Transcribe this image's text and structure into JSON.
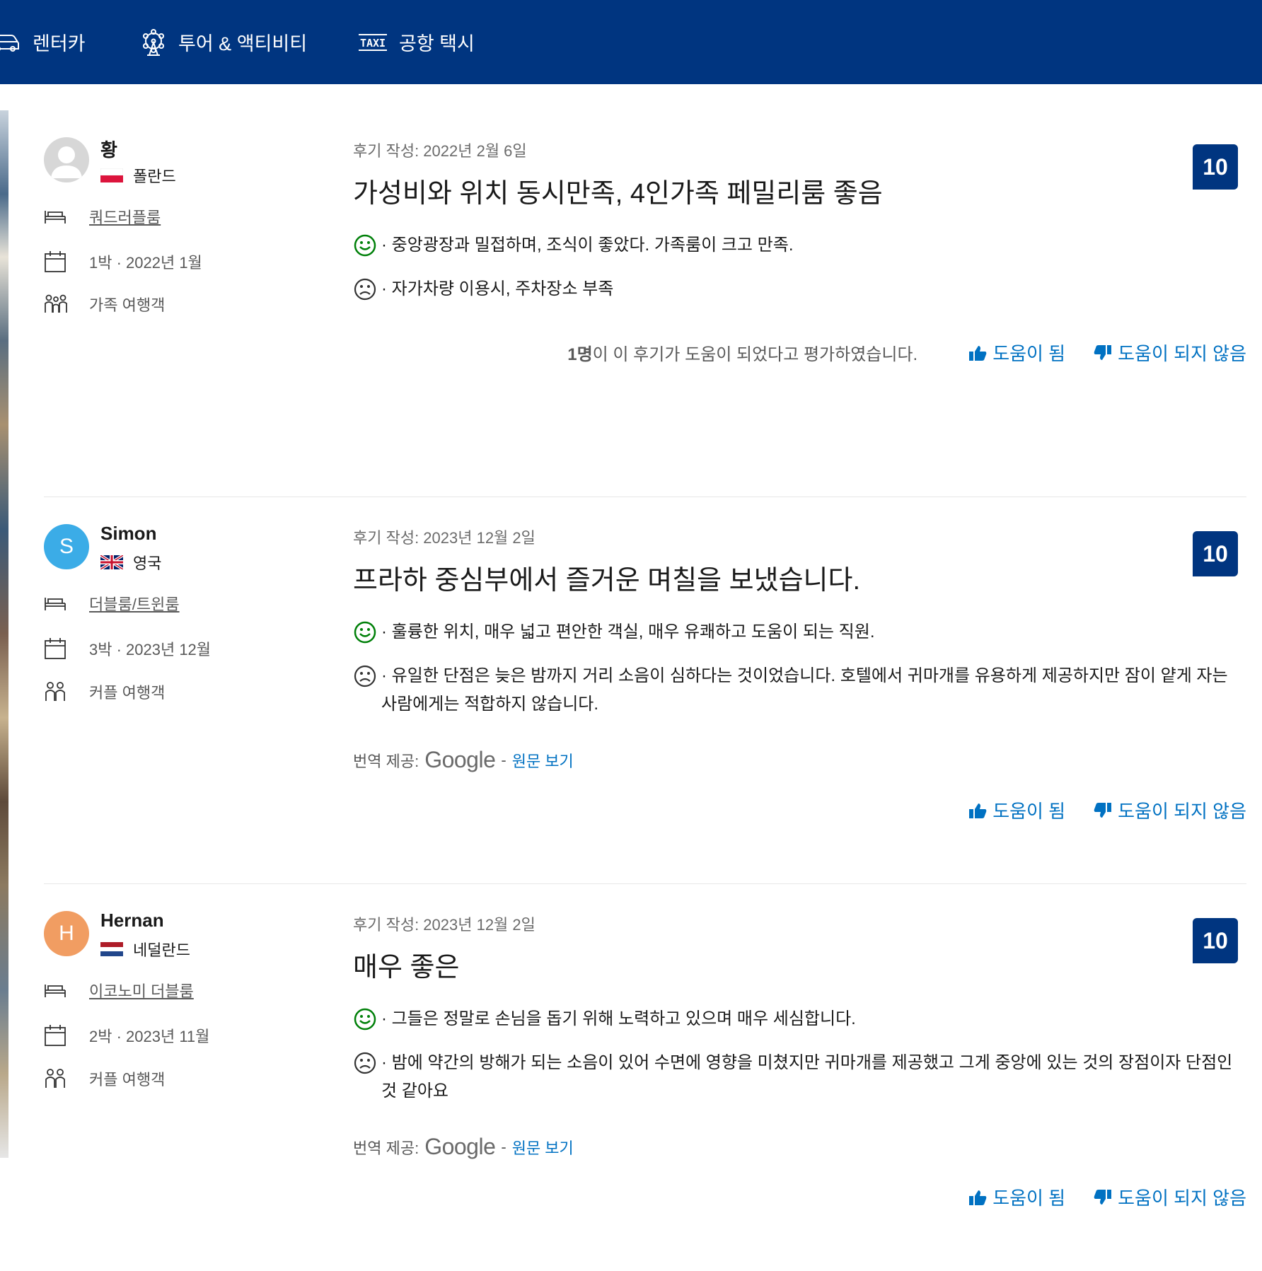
{
  "nav": {
    "items": [
      {
        "label": "렌터카",
        "icon": "car-icon"
      },
      {
        "label": "투어 & 액티비티",
        "icon": "ferris-wheel-icon"
      },
      {
        "label": "공항 택시",
        "icon": "taxi-icon"
      }
    ],
    "taxi_icon_text": "TAXI"
  },
  "colors": {
    "brand": "#003580",
    "link": "#0071c2",
    "positive": "#008009"
  },
  "reviews": [
    {
      "name": "황",
      "avatar_letter": "",
      "avatar_color": "#d7d7d7",
      "country": "폴란드",
      "room": "쿼드러플룸",
      "stay": "1박 ·  2022년 1월",
      "traveler": "가족 여행객",
      "date": "후기 작성: 2022년 2월 6일",
      "title": "가성비와 위치 동시만족, 4인가족 페밀리룸 좋음",
      "score": "10",
      "positive": "· 중앙광장과 밀접하며, 조식이 좋았다. 가족룸이 크고 만족.",
      "negative": "· 자가차량 이용시, 주차장소 부족",
      "helpful_count": "1명",
      "helpful_text": "이 이 후기가 도움이 되었다고 평가하였습니다.",
      "helpful": "도움이 됨",
      "not_helpful": "도움이 되지 않음"
    },
    {
      "name": "Simon",
      "avatar_letter": "S",
      "avatar_color": "#3bace7",
      "country": "영국",
      "room": "더블룸/트윈룸",
      "stay": "3박 ·  2023년 12월",
      "traveler": "커플 여행객",
      "date": "후기 작성: 2023년 12월 2일",
      "title": "프라하 중심부에서 즐거운 며칠을 보냈습니다.",
      "score": "10",
      "positive": "· 훌륭한 위치, 매우 넓고 편안한 객실, 매우 유쾌하고 도움이 되는 직원.",
      "negative": "· 유일한 단점은 늦은 밤까지 거리 소음이 심하다는 것이었습니다. 호텔에서 귀마개를 유용하게 제공하지만 잠이 얕게 자는 사람에게는 적합하지 않습니다.",
      "translation_label": "번역 제공:",
      "translation_brand": "Google",
      "translation_sep": "-",
      "original_link": "원문 보기",
      "helpful": "도움이 됨",
      "not_helpful": "도움이 되지 않음"
    },
    {
      "name": "Hernan",
      "avatar_letter": "H",
      "avatar_color": "#f19d62",
      "country": "네덜란드",
      "room": "이코노미 더블룸",
      "stay": "2박 ·  2023년 11월",
      "traveler": "커플 여행객",
      "date": "후기 작성: 2023년 12월 2일",
      "title": "매우 좋은",
      "score": "10",
      "positive": "· 그들은 정말로 손님을 돕기 위해 노력하고 있으며 매우 세심합니다.",
      "negative": "· 밤에 약간의 방해가 되는 소음이 있어 수면에 영향을 미쳤지만 귀마개를 제공했고 그게 중앙에 있는 것의 장점이자 단점인 것 같아요",
      "translation_label": "번역 제공:",
      "translation_brand": "Google",
      "translation_sep": "-",
      "original_link": "원문 보기",
      "helpful": "도움이 됨",
      "not_helpful": "도움이 되지 않음"
    }
  ]
}
